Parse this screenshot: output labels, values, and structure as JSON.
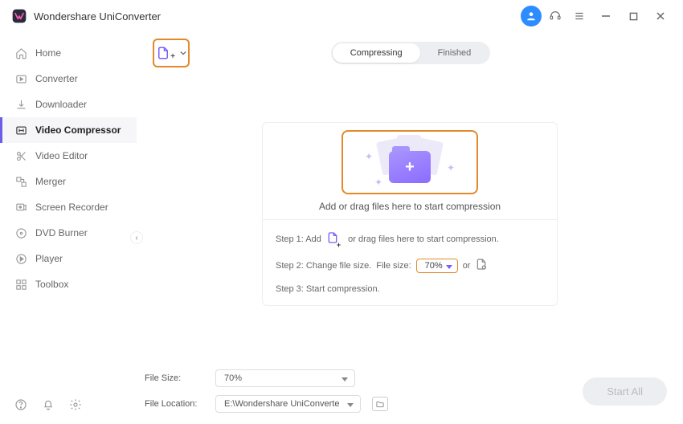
{
  "app": {
    "title": "Wondershare UniConverter"
  },
  "sidebar": {
    "items": [
      {
        "label": "Home"
      },
      {
        "label": "Converter"
      },
      {
        "label": "Downloader"
      },
      {
        "label": "Video Compressor"
      },
      {
        "label": "Video Editor"
      },
      {
        "label": "Merger"
      },
      {
        "label": "Screen Recorder"
      },
      {
        "label": "DVD Burner"
      },
      {
        "label": "Player"
      },
      {
        "label": "Toolbox"
      }
    ]
  },
  "tabs": {
    "compressing": "Compressing",
    "finished": "Finished"
  },
  "drop": {
    "caption": "Add or drag files here to start compression"
  },
  "steps": {
    "s1a": "Step 1: Add",
    "s1b": "or drag files here to start compression.",
    "s2a": "Step 2: Change file size.",
    "s2b": "File size:",
    "s2sel": "70%",
    "s2or": "or",
    "s3": "Step 3: Start compression."
  },
  "footer": {
    "size_label": "File Size:",
    "size_value": "70%",
    "location_label": "File Location:",
    "location_value": "E:\\Wondershare UniConverte",
    "start": "Start All"
  }
}
